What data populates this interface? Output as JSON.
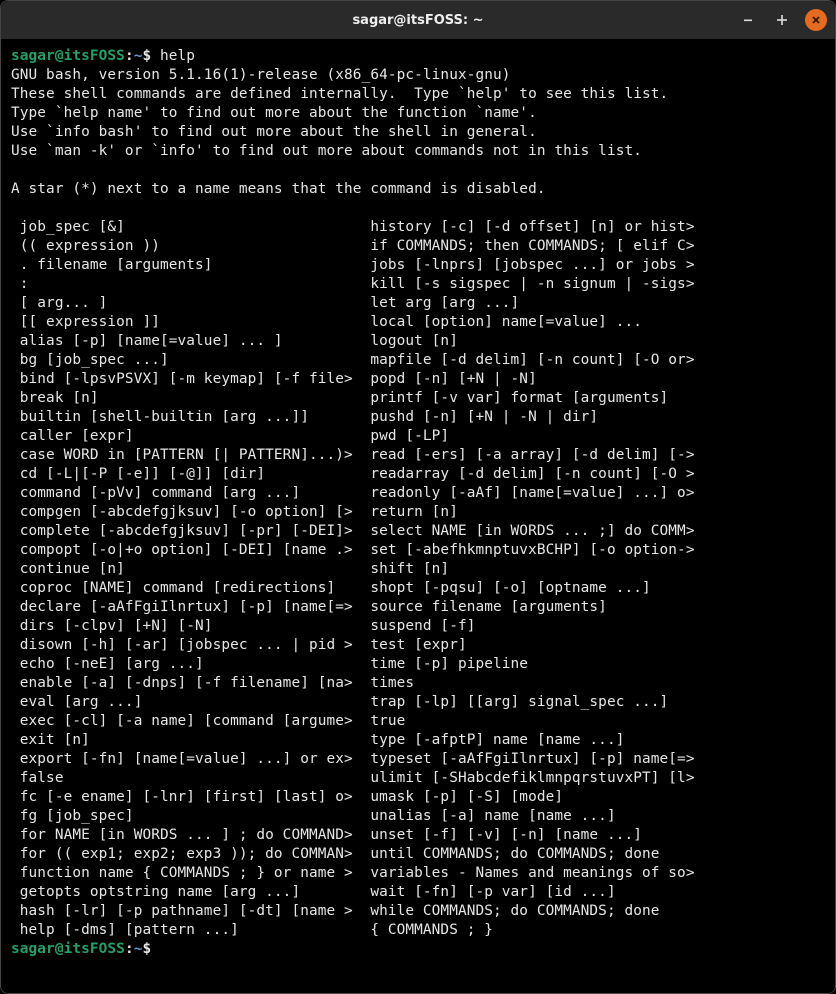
{
  "titlebar": {
    "title": "sagar@itsFOSS: ~"
  },
  "prompt": {
    "user_host": "sagar@itsFOSS",
    "sep1": ":",
    "path": "~",
    "dollar": "$"
  },
  "command": " help",
  "output_lines": [
    "GNU bash, version 5.1.16(1)-release (x86_64-pc-linux-gnu)",
    "These shell commands are defined internally.  Type `help' to see this list.",
    "Type `help name' to find out more about the function `name'.",
    "Use `info bash' to find out more about the shell in general.",
    "Use `man -k' or `info' to find out more about commands not in this list.",
    "",
    "A star (*) next to a name means that the command is disabled.",
    "",
    " job_spec [&]                            history [-c] [-d offset] [n] or hist>",
    " (( expression ))                        if COMMANDS; then COMMANDS; [ elif C>",
    " . filename [arguments]                  jobs [-lnprs] [jobspec ...] or jobs >",
    " :                                       kill [-s sigspec | -n signum | -sigs>",
    " [ arg... ]                              let arg [arg ...]",
    " [[ expression ]]                        local [option] name[=value] ...",
    " alias [-p] [name[=value] ... ]          logout [n]",
    " bg [job_spec ...]                       mapfile [-d delim] [-n count] [-O or>",
    " bind [-lpsvPSVX] [-m keymap] [-f file>  popd [-n] [+N | -N]",
    " break [n]                               printf [-v var] format [arguments]",
    " builtin [shell-builtin [arg ...]]       pushd [-n] [+N | -N | dir]",
    " caller [expr]                           pwd [-LP]",
    " case WORD in [PATTERN [| PATTERN]...)>  read [-ers] [-a array] [-d delim] [->",
    " cd [-L|[-P [-e]] [-@]] [dir]            readarray [-d delim] [-n count] [-O >",
    " command [-pVv] command [arg ...]        readonly [-aAf] [name[=value] ...] o>",
    " compgen [-abcdefgjksuv] [-o option] [>  return [n]",
    " complete [-abcdefgjksuv] [-pr] [-DEI]>  select NAME [in WORDS ... ;] do COMM>",
    " compopt [-o|+o option] [-DEI] [name .>  set [-abefhkmnptuvxBCHP] [-o option->",
    " continue [n]                            shift [n]",
    " coproc [NAME] command [redirections]    shopt [-pqsu] [-o] [optname ...]",
    " declare [-aAfFgiIlnrtux] [-p] [name[=>  source filename [arguments]",
    " dirs [-clpv] [+N] [-N]                  suspend [-f]",
    " disown [-h] [-ar] [jobspec ... | pid >  test [expr]",
    " echo [-neE] [arg ...]                   time [-p] pipeline",
    " enable [-a] [-dnps] [-f filename] [na>  times",
    " eval [arg ...]                          trap [-lp] [[arg] signal_spec ...]",
    " exec [-cl] [-a name] [command [argume>  true",
    " exit [n]                                type [-afptP] name [name ...]",
    " export [-fn] [name[=value] ...] or ex>  typeset [-aAfFgiIlnrtux] [-p] name[=>",
    " false                                   ulimit [-SHabcdefiklmnpqrstuvxPT] [l>",
    " fc [-e ename] [-lnr] [first] [last] o>  umask [-p] [-S] [mode]",
    " fg [job_spec]                           unalias [-a] name [name ...]",
    " for NAME [in WORDS ... ] ; do COMMAND>  unset [-f] [-v] [-n] [name ...]",
    " for (( exp1; exp2; exp3 )); do COMMAN>  until COMMANDS; do COMMANDS; done",
    " function name { COMMANDS ; } or name >  variables - Names and meanings of so>",
    " getopts optstring name [arg ...]        wait [-fn] [-p var] [id ...]",
    " hash [-lr] [-p pathname] [-dt] [name >  while COMMANDS; do COMMANDS; done",
    " help [-dms] [pattern ...]               { COMMANDS ; }"
  ]
}
